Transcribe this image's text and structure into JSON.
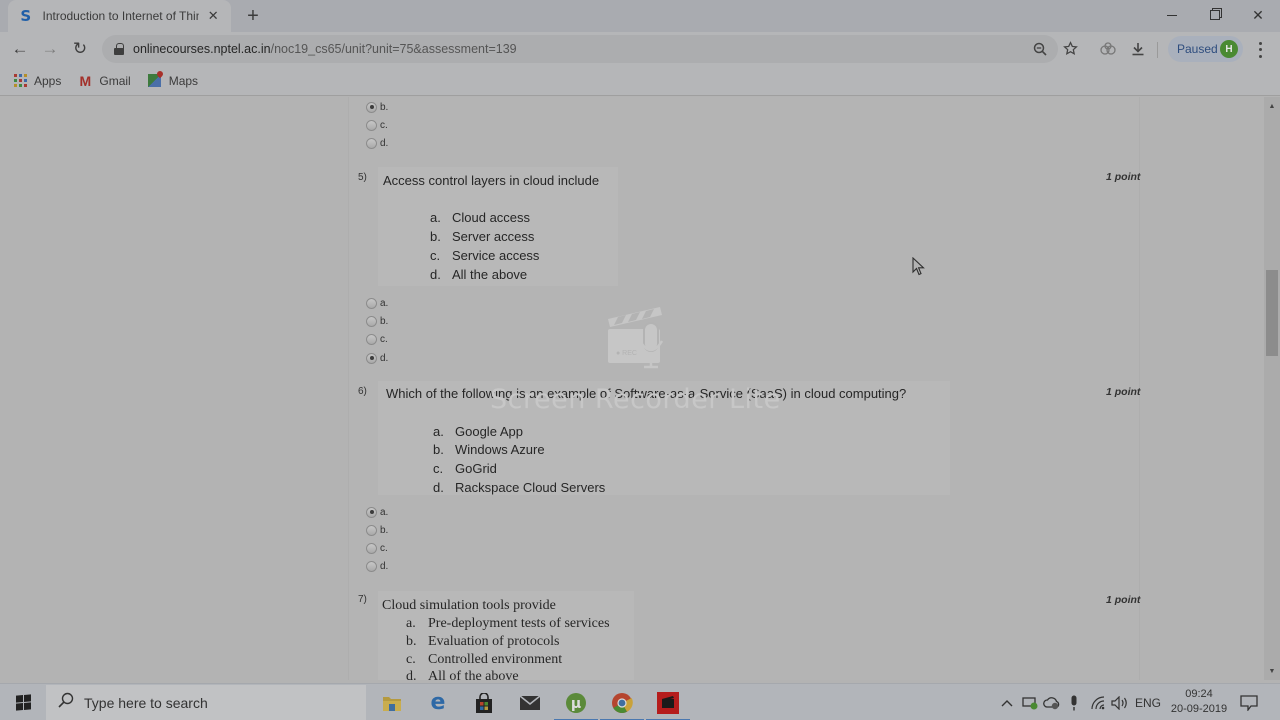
{
  "browser": {
    "tab": {
      "favicon_letter": "S",
      "title": "Introduction to Internet of Things",
      "close_glyph": "✕"
    },
    "new_tab_glyph": "+",
    "window_controls": {
      "minimize": "—",
      "restore": "❐",
      "close": "✕"
    },
    "nav": {
      "back": "←",
      "forward": "→",
      "reload": "↻"
    },
    "address": {
      "host": "onlinecourses.nptel.ac.in",
      "path": "/noc19_cs65/unit?unit=75&assessment=139"
    },
    "omnibox_icons": {
      "zoom": "zoom-out-icon",
      "bookmark": "star-icon"
    },
    "toolbar_icons": {
      "extension": "extension-icon",
      "download": "download-icon"
    },
    "profile": {
      "status": "Paused",
      "initial": "H"
    },
    "bookmarks": [
      {
        "label": "Apps",
        "icon": "apps-grid-icon"
      },
      {
        "label": "Gmail",
        "icon": "gmail-icon"
      },
      {
        "label": "Maps",
        "icon": "maps-icon"
      }
    ]
  },
  "assessment": {
    "prev_question_tail": {
      "options": [
        {
          "label": "b.",
          "checked": true
        },
        {
          "label": "c.",
          "checked": false
        },
        {
          "label": "d.",
          "checked": false
        }
      ]
    },
    "questions": [
      {
        "number": "5)",
        "points": "1 point",
        "text": "Access control layers in cloud include",
        "choices": [
          {
            "letter": "a.",
            "text": "Cloud access"
          },
          {
            "letter": "b.",
            "text": "Server access"
          },
          {
            "letter": "c.",
            "text": "Service access"
          },
          {
            "letter": "d.",
            "text": "All the above"
          }
        ],
        "options": [
          {
            "label": "a.",
            "checked": false
          },
          {
            "label": "b.",
            "checked": false
          },
          {
            "label": "c.",
            "checked": false
          },
          {
            "label": "d.",
            "checked": true
          }
        ]
      },
      {
        "number": "6)",
        "points": "1 point",
        "text": "Which of the following is an example of Software-as-a-Service (SaaS) in cloud computing?",
        "choices": [
          {
            "letter": "a.",
            "text": "Google App"
          },
          {
            "letter": "b.",
            "text": "Windows Azure"
          },
          {
            "letter": "c.",
            "text": "GoGrid"
          },
          {
            "letter": "d.",
            "text": "Rackspace Cloud Servers"
          }
        ],
        "options": [
          {
            "label": "a.",
            "checked": true
          },
          {
            "label": "b.",
            "checked": false
          },
          {
            "label": "c.",
            "checked": false
          },
          {
            "label": "d.",
            "checked": false
          }
        ]
      },
      {
        "number": "7)",
        "points": "1 point",
        "text": "Cloud simulation tools provide",
        "choices": [
          {
            "letter": "a.",
            "text": "Pre-deployment tests of services"
          },
          {
            "letter": "b.",
            "text": "Evaluation of protocols"
          },
          {
            "letter": "c.",
            "text": "Controlled environment"
          },
          {
            "letter": "d.",
            "text": "All of the above"
          }
        ]
      }
    ]
  },
  "watermark": {
    "text": "Screen Recorder Lite",
    "badge": "● REC"
  },
  "taskbar": {
    "search_placeholder": "Type here to search",
    "apps": [
      {
        "name": "file-explorer"
      },
      {
        "name": "edge"
      },
      {
        "name": "store"
      },
      {
        "name": "mail"
      },
      {
        "name": "utorrent",
        "active": true
      },
      {
        "name": "chrome",
        "active": true
      },
      {
        "name": "screen-recorder",
        "active": true
      }
    ],
    "tray": {
      "language": "ENG",
      "time": "09:24",
      "date": "20-09-2019"
    }
  },
  "colors": {
    "overlay_page": "#b3b3b3",
    "profile_avatar": "#4a8a32",
    "taskbar_active": "#4a78b0"
  }
}
